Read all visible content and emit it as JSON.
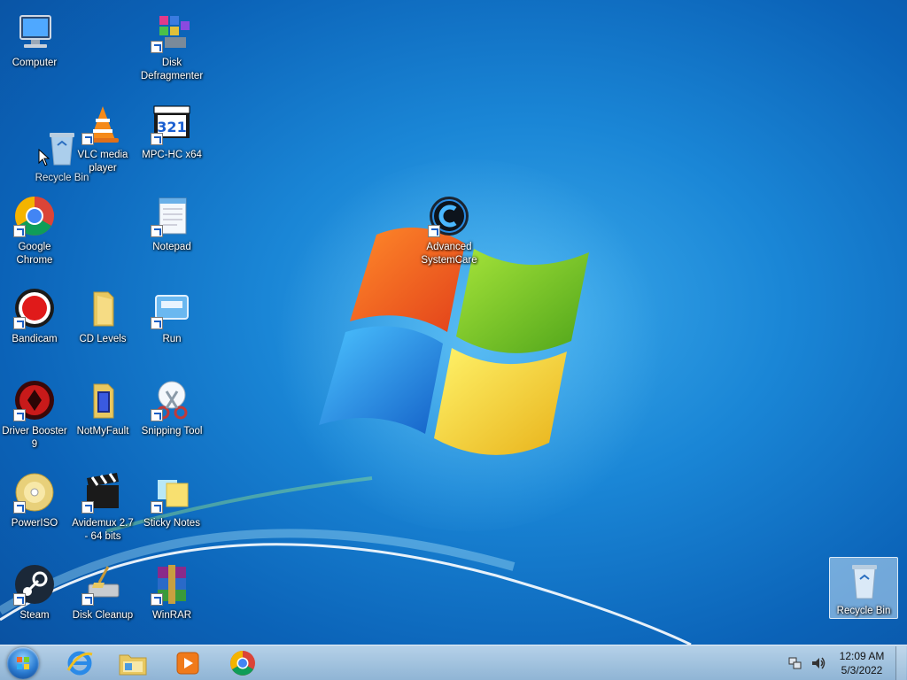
{
  "desktop": {
    "icons": [
      {
        "label": "Computer"
      },
      {
        "label": "Disk Defragmenter"
      },
      {
        "label": "Recycle Bin"
      },
      {
        "label": "VLC media player"
      },
      {
        "label": "MPC-HC x64"
      },
      {
        "label": "Google Chrome"
      },
      {
        "label": "Notepad"
      },
      {
        "label": "Advanced SystemCare"
      },
      {
        "label": "Bandicam"
      },
      {
        "label": "CD Levels"
      },
      {
        "label": "Run"
      },
      {
        "label": "Driver Booster 9"
      },
      {
        "label": "NotMyFault"
      },
      {
        "label": "Snipping Tool"
      },
      {
        "label": "PowerISO"
      },
      {
        "label": "Avidemux 2.7 - 64 bits"
      },
      {
        "label": "Sticky Notes"
      },
      {
        "label": "Steam"
      },
      {
        "label": "Disk Cleanup"
      },
      {
        "label": "WinRAR"
      },
      {
        "label": "Recycle Bin"
      }
    ],
    "mpc_badge": "321"
  },
  "taskbar": {
    "pinned": [
      "internet-explorer",
      "windows-explorer",
      "windows-media-player",
      "google-chrome"
    ],
    "clock_time": "12:09 AM",
    "clock_date": "5/3/2022"
  }
}
